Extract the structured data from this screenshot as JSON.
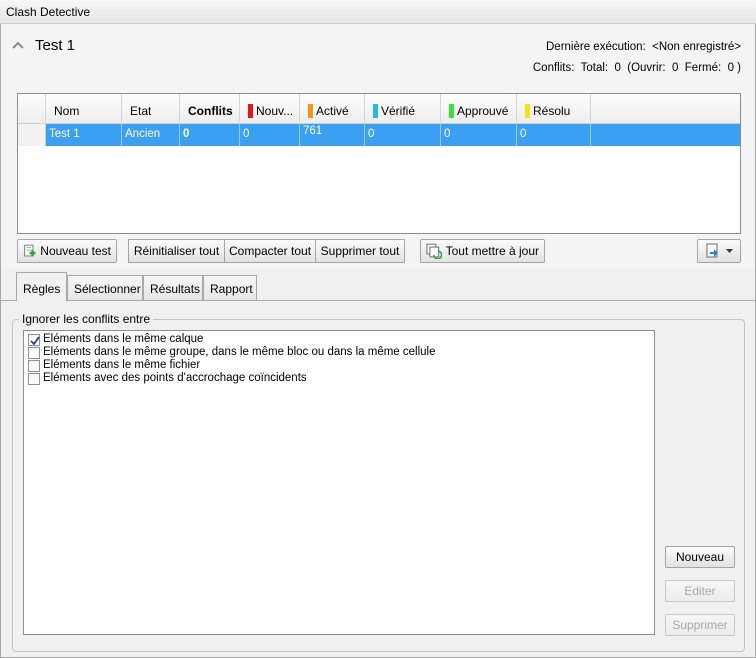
{
  "window": {
    "title": "Clash Detective"
  },
  "header": {
    "test_name": "Test 1",
    "last_run_label": "Dernière exécution:",
    "last_run_value": "<Non enregistré>",
    "summary": "Conflits:  Total:  0  (Ouvrir:  0  Fermé:  0 )"
  },
  "grid": {
    "columns": [
      "Nom",
      "Etat",
      "Conflits",
      "Nouv...",
      "Activé",
      "Vérifié",
      "Approuvé",
      "Résolu"
    ],
    "status_colors": {
      "nouveau": "#e8141b",
      "active": "#f7931e",
      "verifie": "#29b6e8",
      "approuve": "#39e13a",
      "resolu": "#f5e21b"
    },
    "rows": [
      {
        "nom": "Test 1",
        "etat": "Ancien",
        "conflits": "0",
        "nouveau": "0",
        "active": "761",
        "verifie": "0",
        "approuve": "0",
        "resolu": "0"
      }
    ],
    "selection_color": "#3b9ff2"
  },
  "toolbar": {
    "new_test": "Nouveau test",
    "reset_all": "Réinitialiser tout",
    "compact_all": "Compacter tout",
    "delete_all": "Supprimer tout",
    "update_all": "Tout mettre à jour"
  },
  "tabs": [
    "Règles",
    "Sélectionner",
    "Résultats",
    "Rapport"
  ],
  "rules": {
    "group_label": "Ignorer les conflits entre",
    "items": [
      {
        "label": "Eléments dans le même calque",
        "checked": true
      },
      {
        "label": "Eléments dans le même groupe, dans le même bloc ou dans la même cellule",
        "checked": false
      },
      {
        "label": "Eléments dans le même fichier",
        "checked": false
      },
      {
        "label": "Eléments avec des points d'accrochage coïncidents",
        "checked": false
      }
    ],
    "new_button": "Nouveau",
    "edit_button": "Editer",
    "delete_button": "Supprimer"
  }
}
